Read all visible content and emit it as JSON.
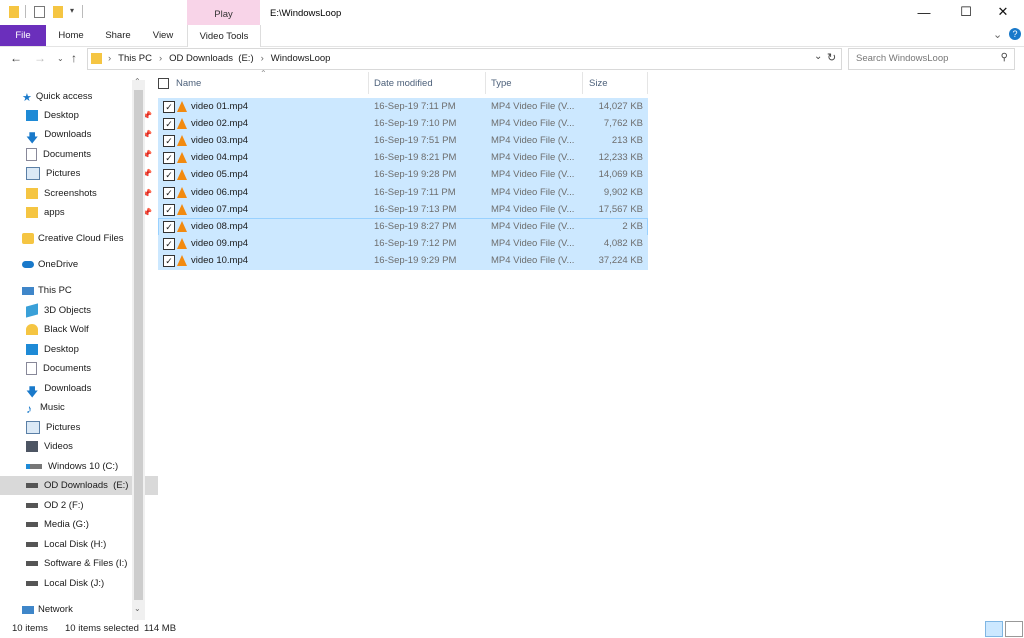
{
  "window": {
    "title": "E:\\WindowsLoop",
    "context_group": "Play",
    "controls": [
      "—",
      "☐",
      "✕"
    ]
  },
  "ribbon": {
    "tabs": [
      "File",
      "Home",
      "Share",
      "View",
      "Video Tools"
    ],
    "expand_glyph": "⌄",
    "help_glyph": "?"
  },
  "address": {
    "crumbs": [
      "This PC",
      "OD Downloads  (E:)",
      "WindowsLoop"
    ],
    "search_placeholder": "Search WindowsLoop"
  },
  "nav": {
    "quick_access": "Quick access",
    "quick_items": [
      "Desktop",
      "Downloads",
      "Documents",
      "Pictures",
      "Screenshots",
      "apps"
    ],
    "creative_cloud": "Creative Cloud Files",
    "onedrive": "OneDrive",
    "this_pc": "This PC",
    "pc_items": [
      "3D Objects",
      "Black Wolf",
      "Desktop",
      "Documents",
      "Downloads",
      "Music",
      "Pictures",
      "Videos",
      "Windows 10 (C:)",
      "OD Downloads  (E:)",
      "OD 2 (F:)",
      "Media (G:)",
      "Local Disk (H:)",
      "Software & Files (I:)",
      "Local Disk (J:)"
    ],
    "network": "Network"
  },
  "columns": [
    "Name",
    "Date modified",
    "Type",
    "Size"
  ],
  "files": [
    {
      "name": "video 01.mp4",
      "date": "16-Sep-19 7:11 PM",
      "type": "MP4 Video File (V...",
      "size": "14,027 KB"
    },
    {
      "name": "video 02.mp4",
      "date": "16-Sep-19 7:10 PM",
      "type": "MP4 Video File (V...",
      "size": "7,762 KB"
    },
    {
      "name": "video 03.mp4",
      "date": "16-Sep-19 7:51 PM",
      "type": "MP4 Video File (V...",
      "size": "213 KB"
    },
    {
      "name": "video 04.mp4",
      "date": "16-Sep-19 8:21 PM",
      "type": "MP4 Video File (V...",
      "size": "12,233 KB"
    },
    {
      "name": "video 05.mp4",
      "date": "16-Sep-19 9:28 PM",
      "type": "MP4 Video File (V...",
      "size": "14,069 KB"
    },
    {
      "name": "video 06.mp4",
      "date": "16-Sep-19 7:11 PM",
      "type": "MP4 Video File (V...",
      "size": "9,902 KB"
    },
    {
      "name": "video 07.mp4",
      "date": "16-Sep-19 7:13 PM",
      "type": "MP4 Video File (V...",
      "size": "17,567 KB"
    },
    {
      "name": "video 08.mp4",
      "date": "16-Sep-19 8:27 PM",
      "type": "MP4 Video File (V...",
      "size": "2 KB"
    },
    {
      "name": "video 09.mp4",
      "date": "16-Sep-19 7:12 PM",
      "type": "MP4 Video File (V...",
      "size": "4,082 KB"
    },
    {
      "name": "video 10.mp4",
      "date": "16-Sep-19 9:29 PM",
      "type": "MP4 Video File (V...",
      "size": "37,224 KB"
    }
  ],
  "status": {
    "count": "10 items",
    "selected": "10 items selected",
    "size": "114 MB"
  },
  "colors": {
    "file_tab": "#6b2fbc",
    "play_context": "#f8d4e8",
    "selection": "#cce8ff"
  }
}
